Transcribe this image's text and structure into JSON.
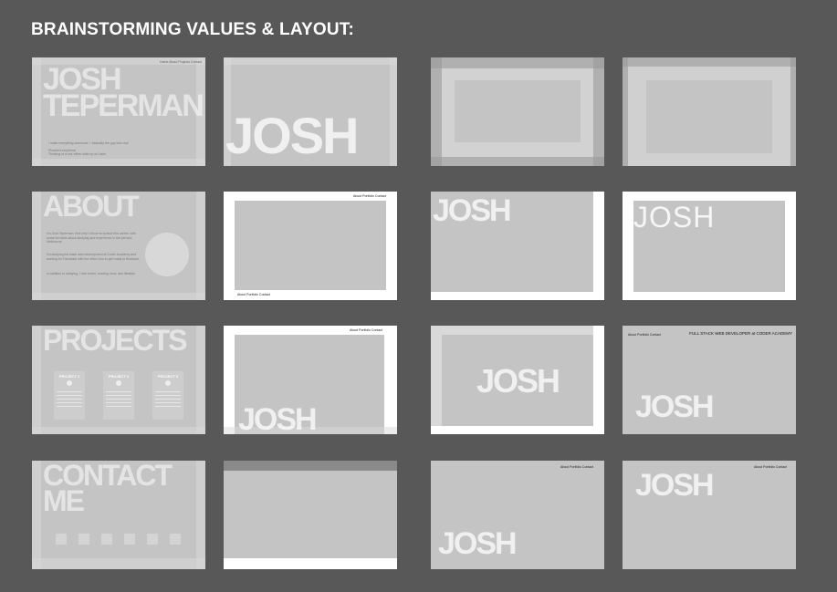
{
  "heading": "BRAINSTORMING VALUES & LAYOUT:",
  "frame1": {
    "nav": "Home About Projects Contact",
    "line1": "JOSH",
    "line2": "TEPERMAN",
    "blurb1": "I make everything awesome + basically the guy who doe",
    "blurb2a": "Phoebe's boyfriend",
    "blurb2b": "Thinking of a cat, either sittin up or t take"
  },
  "frame2": {
    "name": "JOSH"
  },
  "frame5": {
    "title": "ABOUT",
    "p1": "I'm Josh Teperman. And why I chose to pursue this career, with some fun facts about studying and experience in the job and Melbourne.",
    "p2": "I'm studying full stack web development at Coder Academy and working for Fairwaste with the other Goo to get ready to Brisbane.",
    "p3": "In addition to studying, I love travel, reading, food, and lifestyle."
  },
  "frame6": {
    "nav_top": "About Portfolio Contact",
    "nav_bottom": "About Portfolio Contact"
  },
  "frame7": {
    "name": "JOSH"
  },
  "frame8": {
    "name": "JOSH"
  },
  "frame9": {
    "title": "PROJECTS",
    "cards": [
      {
        "title": "PROJECT 1"
      },
      {
        "title": "PROJECT 2"
      },
      {
        "title": "PROJECT 3"
      }
    ]
  },
  "frame10": {
    "nav": "About Portfolio Contact",
    "name": "JOSH"
  },
  "frame11": {
    "name": "JOSH"
  },
  "frame12": {
    "nav": "About Portfolio Contact",
    "tagline": "FULL STACK WEB DEVELOPER at CODER ACADEMY",
    "name": "JOSH"
  },
  "frame13": {
    "line1": "CONTACT",
    "line2": "ME"
  },
  "frame15": {
    "nav": "About Portfolio Contact",
    "name": "JOSH"
  },
  "frame16": {
    "nav": "About Portfolio Contact",
    "name": "JOSH"
  }
}
